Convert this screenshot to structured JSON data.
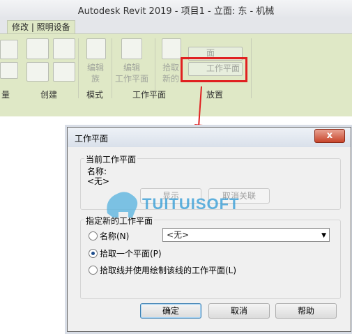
{
  "window": {
    "title": "Autodesk Revit 2019 - 项目1 - 立面: 东 - 机械"
  },
  "ribbon": {
    "tab_label": "修改 | 照明设备",
    "buttons": [
      {
        "label": "编辑\n族",
        "icon": "edit-family-icon"
      },
      {
        "label": "编辑\n工作平面",
        "icon": "edit-workplane-icon"
      },
      {
        "label": "拾取\n新的",
        "icon": "pick-new-icon"
      }
    ],
    "place_items": [
      {
        "label": "面",
        "icon": "face-icon"
      },
      {
        "label": "工作平面",
        "icon": "workplane-icon"
      }
    ],
    "groups": [
      "量",
      "创建",
      "模式",
      "工作平面",
      "放置"
    ]
  },
  "dialog": {
    "title": "工作平面",
    "close_label": "x",
    "current": {
      "legend": "当前工作平面",
      "name_label": "名称:",
      "name_value": "<无>",
      "show_button": "显示",
      "disassociate_button": "取消关联"
    },
    "specify": {
      "legend": "指定新的工作平面",
      "options": [
        {
          "label": "名称(N)",
          "selected": false
        },
        {
          "label": "拾取一个平面(P)",
          "selected": true
        },
        {
          "label": "拾取线并使用绘制该线的工作平面(L)",
          "selected": false
        }
      ],
      "name_select_value": "<无>"
    },
    "ok_button": "确定",
    "cancel_button": "取消",
    "help_button": "帮助"
  },
  "watermark": {
    "text": "TUITUISOFT"
  },
  "colors": {
    "ribbon_bg": "#dfe8c6",
    "highlight": "#e02020",
    "radio_dot": "#1c4c8c"
  }
}
